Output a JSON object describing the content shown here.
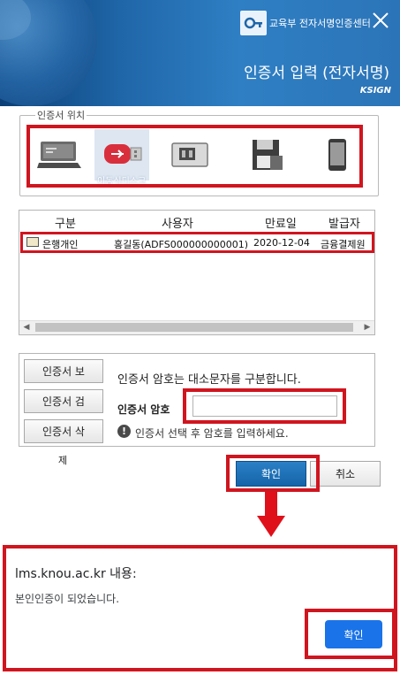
{
  "window": {
    "org_name": "교육부 전자서명인증센터",
    "title": "인증서 입력 (전자서명)",
    "brand": "KSIGN"
  },
  "location": {
    "legend": "인증서 위치",
    "selected_label": "이동식디스크",
    "items": [
      {
        "icon": "hard-disk-icon"
      },
      {
        "icon": "usb-drive-icon",
        "selected": true
      },
      {
        "icon": "smart-card-icon"
      },
      {
        "icon": "floppy-disk-icon"
      },
      {
        "icon": "mobile-phone-icon"
      }
    ]
  },
  "cert_table": {
    "headers": [
      "구분",
      "사용자",
      "만료일",
      "발급자"
    ],
    "rows": [
      {
        "type": "은행개인",
        "user": "홍길동(ADFS000000000001)",
        "expiry": "2020-12-04",
        "issuer": "금융결제원"
      }
    ]
  },
  "side_buttons": {
    "view": "인증서 보",
    "search": "인증서 검",
    "delete": "인증서 삭",
    "stub": "제"
  },
  "password": {
    "hint": "인증서 암호는 대소문자를 구분합니다.",
    "label": "인증서 암호",
    "value": "",
    "warning": "인증서 선택 후 암호를 입력하세요."
  },
  "actions": {
    "ok": "확인",
    "cancel": "취소"
  },
  "alert": {
    "title": "lms.knou.ac.kr 내용:",
    "message": "본인인증이 되었습니다.",
    "ok": "확인"
  },
  "colors": {
    "highlight": "#d0151f",
    "header": "#2f7fc4",
    "ok_button": "#1564a9",
    "alert_button": "#1a73e8"
  }
}
